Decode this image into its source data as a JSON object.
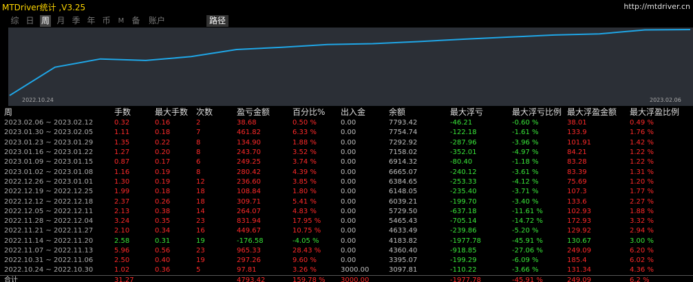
{
  "app": {
    "title": "MTDriver统计 ,V3.25",
    "url": "http://mtdriver.cn"
  },
  "tabs": [
    "综",
    "日",
    "周",
    "月",
    "季",
    "年",
    "币",
    "M",
    "备",
    "账户",
    "路径"
  ],
  "active_tab": "周",
  "colors": {
    "line": "#1fa7e8",
    "positive": "#ff2a2a",
    "negative": "#39e639",
    "neutral": "#bfbfbf",
    "title": "#ffd700"
  },
  "chart_data": {
    "type": "line",
    "x_start_label": "2022.10.24",
    "x_end_label": "2023.02.06",
    "series": [
      {
        "values": [
          97.81,
          3395.07,
          4360.4,
          4183.82,
          4633.49,
          5465.43,
          5729.5,
          6039.21,
          6148.05,
          6384.65,
          6665.07,
          6914.32,
          7158.02,
          7292.92,
          7754.74,
          7793.42
        ]
      }
    ]
  },
  "table": {
    "headers": [
      "周",
      "手数",
      "最大手数",
      "次数",
      "盈亏金额",
      "百分比%",
      "出入金",
      "余额",
      "最大浮亏",
      "最大浮亏比例",
      "最大浮盈金额",
      "最大浮盈比例"
    ],
    "rows": [
      [
        "2023.02.06 ~ 2023.02.12",
        "0.32",
        "0.16",
        "2",
        "38.68",
        "0.50 %",
        "0.00",
        "7793.42",
        "-46.21",
        "-0.60 %",
        "38.01",
        "0.49 %"
      ],
      [
        "2023.01.30 ~ 2023.02.05",
        "1.11",
        "0.18",
        "7",
        "461.82",
        "6.33 %",
        "0.00",
        "7754.74",
        "-122.18",
        "-1.61 %",
        "133.9",
        "1.76 %"
      ],
      [
        "2023.01.23 ~ 2023.01.29",
        "1.35",
        "0.22",
        "8",
        "134.90",
        "1.88 %",
        "0.00",
        "7292.92",
        "-287.96",
        "-3.96 %",
        "101.91",
        "1.42 %"
      ],
      [
        "2023.01.16 ~ 2023.01.22",
        "1.27",
        "0.20",
        "8",
        "243.70",
        "3.52 %",
        "0.00",
        "7158.02",
        "-352.01",
        "-4.97 %",
        "84.21",
        "1.22 %"
      ],
      [
        "2023.01.09 ~ 2023.01.15",
        "0.87",
        "0.17",
        "6",
        "249.25",
        "3.74 %",
        "0.00",
        "6914.32",
        "-80.40",
        "-1.18 %",
        "83.28",
        "1.22 %"
      ],
      [
        "2023.01.02 ~ 2023.01.08",
        "1.16",
        "0.19",
        "8",
        "280.42",
        "4.39 %",
        "0.00",
        "6665.07",
        "-240.12",
        "-3.61 %",
        "83.39",
        "1.31 %"
      ],
      [
        "2022.12.26 ~ 2023.01.01",
        "1.30",
        "0.19",
        "12",
        "236.60",
        "3.85 %",
        "0.00",
        "6384.65",
        "-253.33",
        "-4.12 %",
        "75.69",
        "1.20 %"
      ],
      [
        "2022.12.19 ~ 2022.12.25",
        "1.99",
        "0.18",
        "18",
        "108.84",
        "1.80 %",
        "0.00",
        "6148.05",
        "-235.40",
        "-3.71 %",
        "107.3",
        "1.77 %"
      ],
      [
        "2022.12.12 ~ 2022.12.18",
        "2.37",
        "0.26",
        "18",
        "309.71",
        "5.41 %",
        "0.00",
        "6039.21",
        "-199.70",
        "-3.40 %",
        "133.6",
        "2.27 %"
      ],
      [
        "2022.12.05 ~ 2022.12.11",
        "2.13",
        "0.38",
        "14",
        "264.07",
        "4.83 %",
        "0.00",
        "5729.50",
        "-637.18",
        "-11.61 %",
        "102.93",
        "1.88 %"
      ],
      [
        "2022.11.28 ~ 2022.12.04",
        "3.24",
        "0.35",
        "23",
        "831.94",
        "17.95 %",
        "0.00",
        "5465.43",
        "-705.14",
        "-14.72 %",
        "172.93",
        "3.32 %"
      ],
      [
        "2022.11.21 ~ 2022.11.27",
        "2.10",
        "0.34",
        "16",
        "449.67",
        "10.75 %",
        "0.00",
        "4633.49",
        "-239.86",
        "-5.20 %",
        "129.92",
        "2.94 %"
      ],
      [
        "2022.11.14 ~ 2022.11.20",
        "2.58",
        "0.31",
        "19",
        "-176.58",
        "-4.05 %",
        "0.00",
        "4183.82",
        "-1977.78",
        "-45.91 %",
        "130.67",
        "3.00 %"
      ],
      [
        "2022.11.07 ~ 2022.11.13",
        "5.96",
        "0.56",
        "23",
        "965.33",
        "28.43 %",
        "0.00",
        "4360.40",
        "-918.85",
        "-27.06 %",
        "249.09",
        "6.20 %"
      ],
      [
        "2022.10.31 ~ 2022.11.06",
        "2.50",
        "0.40",
        "19",
        "297.26",
        "9.60 %",
        "0.00",
        "3395.07",
        "-199.29",
        "-6.09 %",
        "185.4",
        "6.02 %"
      ],
      [
        "2022.10.24 ~ 2022.10.30",
        "1.02",
        "0.36",
        "5",
        "97.81",
        "3.26 %",
        "3000.00",
        "3097.81",
        "-110.22",
        "-3.66 %",
        "131.34",
        "4.36 %"
      ]
    ],
    "total": [
      "合计",
      "31.27",
      "",
      "",
      "4793.42",
      "159.78 %",
      "3000.00",
      "",
      "-1977.78",
      "-45.91 %",
      "249.09",
      "6.2 %"
    ]
  }
}
